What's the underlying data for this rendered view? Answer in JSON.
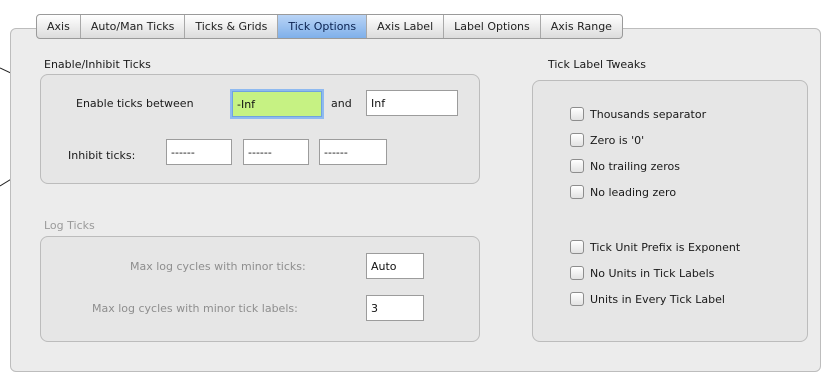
{
  "tabs": [
    {
      "label": "Axis",
      "active": false
    },
    {
      "label": "Auto/Man Ticks",
      "active": false
    },
    {
      "label": "Ticks & Grids",
      "active": false
    },
    {
      "label": "Tick Options",
      "active": true
    },
    {
      "label": "Axis Label",
      "active": false
    },
    {
      "label": "Label Options",
      "active": false
    },
    {
      "label": "Axis Range",
      "active": false
    }
  ],
  "enable_inhibit": {
    "title": "Enable/Inhibit Ticks",
    "enable_label": "Enable ticks between",
    "enable_from": "-Inf",
    "and_label": "and",
    "enable_to": "Inf",
    "inhibit_label": "Inhibit ticks:",
    "inhibit_values": [
      "------",
      "------",
      "------"
    ]
  },
  "log_ticks": {
    "title": "Log Ticks",
    "max_minor_ticks_label": "Max log cycles with minor ticks:",
    "max_minor_ticks_value": "Auto",
    "max_minor_labels_label": "Max log cycles with minor tick labels:",
    "max_minor_labels_value": "3"
  },
  "tick_label_tweaks": {
    "title": "Tick Label Tweaks",
    "group_a": [
      {
        "label": "Thousands separator",
        "checked": false
      },
      {
        "label": "Zero is '0'",
        "checked": false
      },
      {
        "label": "No trailing zeros",
        "checked": false
      },
      {
        "label": "No leading zero",
        "checked": false
      }
    ],
    "group_b": [
      {
        "label": "Tick Unit Prefix is Exponent",
        "checked": false
      },
      {
        "label": "No Units in Tick Labels",
        "checked": false
      },
      {
        "label": "Units in Every Tick Label",
        "checked": false
      }
    ]
  },
  "colors": {
    "active_tab": "#7fb0ea",
    "focused_field": "#c6f283",
    "panel_bg": "#ececec"
  }
}
